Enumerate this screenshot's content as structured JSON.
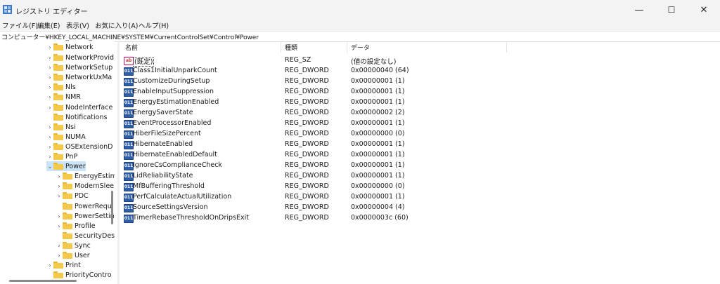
{
  "window": {
    "title": "レジストリ エディター"
  },
  "window_controls": {
    "minimize": "—",
    "maximize": "☐",
    "close": "✕"
  },
  "menu": [
    {
      "label": "ファイル(F)"
    },
    {
      "label": "編集(E)"
    },
    {
      "label": "表示(V)"
    },
    {
      "label": "お気に入り(A)"
    },
    {
      "label": "ヘルプ(H)"
    }
  ],
  "address": "コンピューター¥HKEY_LOCAL_MACHINE¥SYSTEM¥CurrentControlSet¥Control¥Power",
  "tree": [
    {
      "label": "Network",
      "expander": "›"
    },
    {
      "label": "NetworkProvid",
      "expander": "›"
    },
    {
      "label": "NetworkSetup",
      "expander": "›"
    },
    {
      "label": "NetworkUxMa",
      "expander": "›"
    },
    {
      "label": "Nls",
      "expander": "›"
    },
    {
      "label": "NMR",
      "expander": "›"
    },
    {
      "label": "NodeInterface",
      "expander": "›"
    },
    {
      "label": "Notifications",
      "expander": ""
    },
    {
      "label": "Nsi",
      "expander": "›"
    },
    {
      "label": "NUMA",
      "expander": "›"
    },
    {
      "label": "OSExtensionD",
      "expander": "›"
    },
    {
      "label": "PnP",
      "expander": "›"
    },
    {
      "label": "Power",
      "expander": "⌄"
    },
    {
      "label": "EnergyEstim",
      "expander": "›"
    },
    {
      "label": "ModernSlee",
      "expander": "›"
    },
    {
      "label": "PDC",
      "expander": "›"
    },
    {
      "label": "PowerRequ",
      "expander": ""
    },
    {
      "label": "PowerSettin",
      "expander": "›"
    },
    {
      "label": "Profile",
      "expander": "›"
    },
    {
      "label": "SecurityDes",
      "expander": ""
    },
    {
      "label": "Sync",
      "expander": "›"
    },
    {
      "label": "User",
      "expander": "›"
    },
    {
      "label": "Print",
      "expander": "›"
    },
    {
      "label": "PriorityContro",
      "expander": ""
    }
  ],
  "columns": {
    "name": "名前",
    "type": "種類",
    "data": "データ"
  },
  "values": [
    {
      "icon": "ab",
      "name": "(既定)",
      "type": "REG_SZ",
      "data": "(値の設定なし)"
    },
    {
      "icon": "011",
      "name": "Class1InitialUnparkCount",
      "type": "REG_DWORD",
      "data": "0x00000040 (64)"
    },
    {
      "icon": "011",
      "name": "CustomizeDuringSetup",
      "type": "REG_DWORD",
      "data": "0x00000001 (1)"
    },
    {
      "icon": "011",
      "name": "EnableInputSuppression",
      "type": "REG_DWORD",
      "data": "0x00000001 (1)"
    },
    {
      "icon": "011",
      "name": "EnergyEstimationEnabled",
      "type": "REG_DWORD",
      "data": "0x00000001 (1)"
    },
    {
      "icon": "011",
      "name": "EnergySaverState",
      "type": "REG_DWORD",
      "data": "0x00000002 (2)"
    },
    {
      "icon": "011",
      "name": "EventProcessorEnabled",
      "type": "REG_DWORD",
      "data": "0x00000001 (1)"
    },
    {
      "icon": "011",
      "name": "HiberFileSizePercent",
      "type": "REG_DWORD",
      "data": "0x00000000 (0)"
    },
    {
      "icon": "011",
      "name": "HibernateEnabled",
      "type": "REG_DWORD",
      "data": "0x00000001 (1)"
    },
    {
      "icon": "011",
      "name": "HibernateEnabledDefault",
      "type": "REG_DWORD",
      "data": "0x00000001 (1)"
    },
    {
      "icon": "011",
      "name": "IgnoreCsComplianceCheck",
      "type": "REG_DWORD",
      "data": "0x00000001 (1)"
    },
    {
      "icon": "011",
      "name": "LidReliabilityState",
      "type": "REG_DWORD",
      "data": "0x00000001 (1)"
    },
    {
      "icon": "011",
      "name": "MfBufferingThreshold",
      "type": "REG_DWORD",
      "data": "0x00000000 (0)"
    },
    {
      "icon": "011",
      "name": "PerfCalculateActualUtilization",
      "type": "REG_DWORD",
      "data": "0x00000001 (1)"
    },
    {
      "icon": "011",
      "name": "SourceSettingsVersion",
      "type": "REG_DWORD",
      "data": "0x00000004 (4)"
    },
    {
      "icon": "011",
      "name": "TimerRebaseThresholdOnDripsExit",
      "type": "REG_DWORD",
      "data": "0x0000003c (60)"
    }
  ]
}
